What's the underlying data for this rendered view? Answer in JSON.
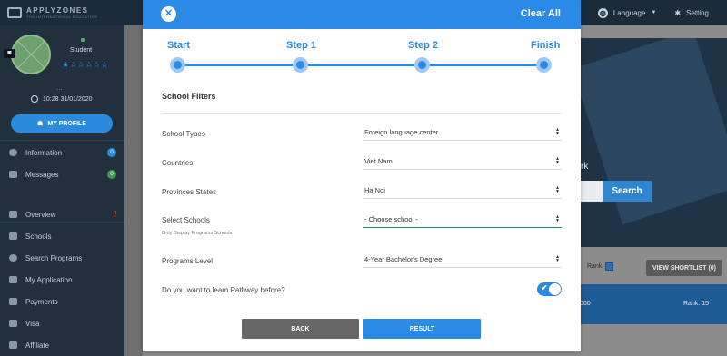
{
  "app": {
    "logo_text": "APPLYZONES",
    "logo_tagline": "THE INTERNATIONAL EDUCATION",
    "top_nav": {
      "language_label": "Language",
      "setting_label": "Setting"
    }
  },
  "sidebar": {
    "role": "Student",
    "rating_stars": "★☆☆☆☆☆",
    "name_placeholder": "...",
    "datetime": "10:28 31/01/2020",
    "profile_button": "MY PROFILE",
    "top_items": [
      {
        "label": "Information",
        "badge": "0",
        "icon": "info-icon"
      },
      {
        "label": "Messages",
        "badge": "0",
        "icon": "chat-icon"
      }
    ],
    "items": [
      {
        "label": "Overview",
        "icon": "home-icon"
      },
      {
        "label": "Schools",
        "icon": "school-icon"
      },
      {
        "label": "Search Programs",
        "icon": "search-icon"
      },
      {
        "label": "My Application",
        "icon": "application-icon"
      },
      {
        "label": "Payments",
        "icon": "payment-icon"
      },
      {
        "label": "Visa",
        "icon": "visa-icon"
      },
      {
        "label": "Affiliate",
        "icon": "affiliate-icon"
      }
    ]
  },
  "background": {
    "hero_text": "rk",
    "search_button": "Search",
    "rank_label": "Rank",
    "shortlist_button": "VIEW SHORTLIST (0)",
    "result_left": "000",
    "result_rank": "Rank: 15"
  },
  "modal": {
    "clear_all": "Clear All",
    "steps": [
      "Start",
      "Step 1",
      "Step 2",
      "Finish"
    ],
    "section_title": "School Filters",
    "fields": [
      {
        "label": "School Types",
        "value": "Foreign language center"
      },
      {
        "label": "Countries",
        "value": "Viet Nam"
      },
      {
        "label": "Provinces States",
        "value": "Ha Noi"
      },
      {
        "label": "Select Schools",
        "sublabel": "Only Display Programs Schools",
        "value": "- Choose school -"
      },
      {
        "label": "Programs Level",
        "value": "4-Year Bachelor's Degree"
      }
    ],
    "pathway_question": "Do you want to learn Pathway before?",
    "pathway_enabled": true,
    "back_button": "BACK",
    "result_button": "RESULT"
  },
  "colors": {
    "accent": "#2b8ae5",
    "sidebar_bg": "#22303e",
    "topbar_bg": "#1c2b3a",
    "back_button_bg": "#666666",
    "active_underline": "#1d8f6b"
  }
}
